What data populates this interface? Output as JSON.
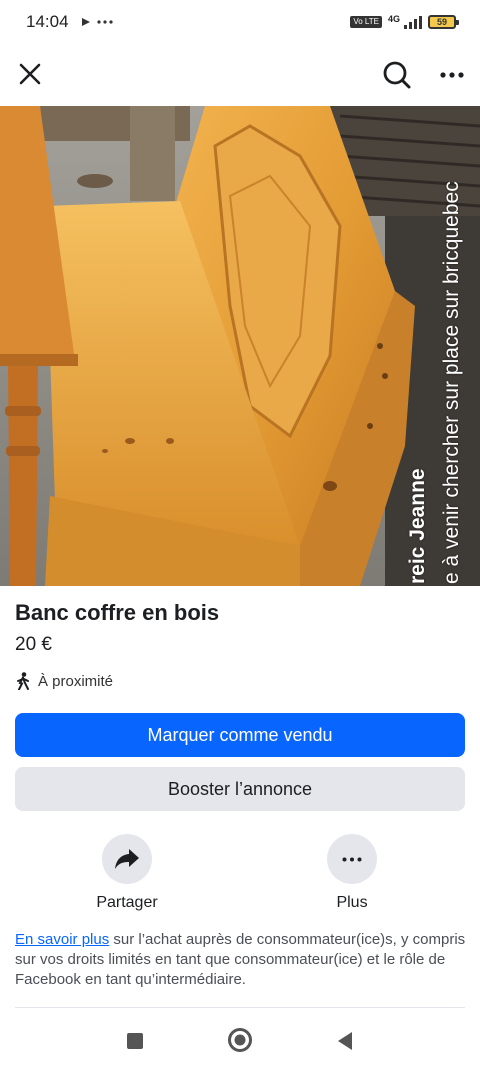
{
  "status_bar": {
    "time": "14:04",
    "network": "4G",
    "volte": "Vo LTE",
    "battery": "59"
  },
  "top_bar": {
    "close_icon": "close-icon",
    "search_icon": "search-icon",
    "more_icon": "more-horizontal-icon"
  },
  "listing": {
    "watermark_line1": "reic Jeanne",
    "watermark_line2": "e à venir chercher sur place sur bricquebec",
    "title": "Banc coffre en bois",
    "price": "20 €",
    "location": "À proximité",
    "location_icon": "walking-person-icon"
  },
  "actions": {
    "mark_sold": "Marquer comme vendu",
    "boost": "Booster l’annonce",
    "share_label": "Partager",
    "more_label": "Plus"
  },
  "info": {
    "link": "En savoir plus",
    "text": " sur l’achat auprès de consommateur(ice)s, y compris sur vos droits limités en tant que consommateur(ice) et le rôle de Facebook en tant qu’intermédiaire."
  },
  "colors": {
    "primary": "#0866ff",
    "secondary": "#e4e6eb",
    "text": "#1c1e21"
  }
}
